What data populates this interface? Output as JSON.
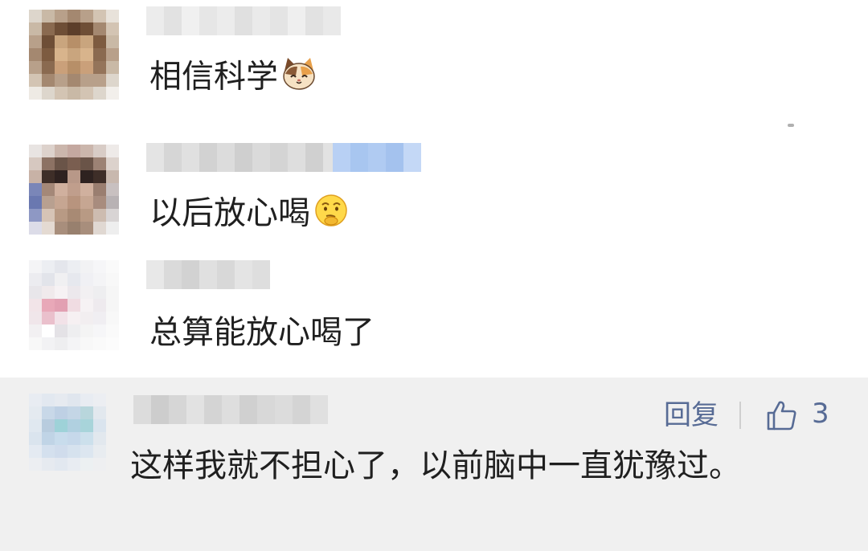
{
  "comments": [
    {
      "text": "相信科学",
      "emoji": "cat-face-emoji"
    },
    {
      "text": "以后放心喝",
      "emoji": "thinking-face-emoji"
    },
    {
      "text": "总算能放心喝了"
    }
  ],
  "highlighted_comment": {
    "text": "这样我就不担心了，以前脑中一直犹豫过。",
    "reply_label": "回复",
    "like_count": "3"
  },
  "colors": {
    "accent": "#576b95",
    "highlight_bg": "#f0f0f0",
    "text": "#1f1f1f"
  }
}
